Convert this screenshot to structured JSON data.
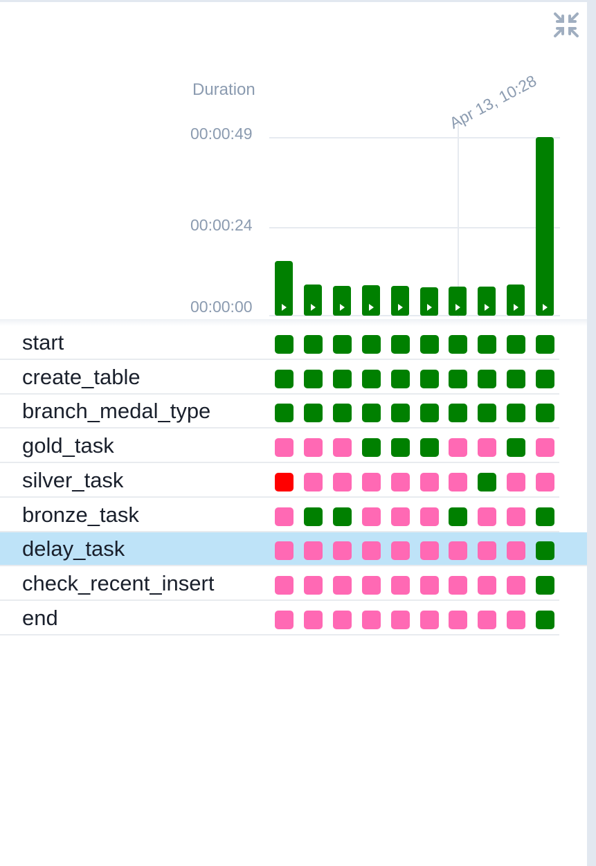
{
  "chart": {
    "title": "Duration",
    "y_ticks": [
      "00:00:49",
      "00:00:24",
      "00:00:00"
    ],
    "marker_label": "Apr 13, 10:28"
  },
  "chart_data": {
    "type": "bar",
    "title": "",
    "ylabel": "Duration",
    "unit": "seconds",
    "ylim": [
      0,
      49
    ],
    "values": [
      15,
      8.5,
      8.2,
      8.3,
      8.2,
      7.8,
      8,
      8,
      8.5,
      49
    ]
  },
  "status_colors": {
    "success": "#008000",
    "skipped": "#ff69b4",
    "failed": "#ff0000"
  },
  "tasks": [
    {
      "name": "start",
      "states": [
        "success",
        "success",
        "success",
        "success",
        "success",
        "success",
        "success",
        "success",
        "success",
        "success"
      ]
    },
    {
      "name": "create_table",
      "states": [
        "success",
        "success",
        "success",
        "success",
        "success",
        "success",
        "success",
        "success",
        "success",
        "success"
      ]
    },
    {
      "name": "branch_medal_type",
      "states": [
        "success",
        "success",
        "success",
        "success",
        "success",
        "success",
        "success",
        "success",
        "success",
        "success"
      ]
    },
    {
      "name": "gold_task",
      "states": [
        "skipped",
        "skipped",
        "skipped",
        "success",
        "success",
        "success",
        "skipped",
        "skipped",
        "success",
        "skipped"
      ]
    },
    {
      "name": "silver_task",
      "states": [
        "failed",
        "skipped",
        "skipped",
        "skipped",
        "skipped",
        "skipped",
        "skipped",
        "success",
        "skipped",
        "skipped"
      ]
    },
    {
      "name": "bronze_task",
      "states": [
        "skipped",
        "success",
        "success",
        "skipped",
        "skipped",
        "skipped",
        "success",
        "skipped",
        "skipped",
        "success"
      ]
    },
    {
      "name": "delay_task",
      "selected": true,
      "states": [
        "skipped",
        "skipped",
        "skipped",
        "skipped",
        "skipped",
        "skipped",
        "skipped",
        "skipped",
        "skipped",
        "success"
      ]
    },
    {
      "name": "check_recent_insert",
      "states": [
        "skipped",
        "skipped",
        "skipped",
        "skipped",
        "skipped",
        "skipped",
        "skipped",
        "skipped",
        "skipped",
        "success"
      ]
    },
    {
      "name": "end",
      "states": [
        "skipped",
        "skipped",
        "skipped",
        "skipped",
        "skipped",
        "skipped",
        "skipped",
        "skipped",
        "skipped",
        "success"
      ]
    }
  ],
  "icons": {
    "collapse": "collapse-icon",
    "play": "play-icon"
  }
}
